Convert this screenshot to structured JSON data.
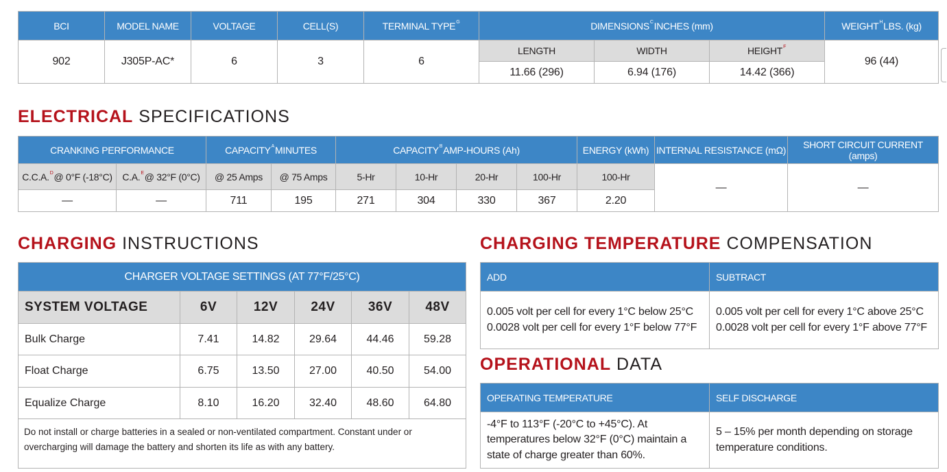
{
  "top": {
    "headers": {
      "bci": "BCI",
      "model": "MODEL NAME",
      "voltage": "VOLTAGE",
      "cells": "CELL(S)",
      "terminal": "TERMINAL TYPE",
      "terminal_sup": "G",
      "dimensions": "DIMENSIONS",
      "dimensions_sup": "C",
      "dimensions_units": "INCHES (mm)",
      "weight": "WEIGHT",
      "weight_sup": "H",
      "weight_units": "LBS. (kg)"
    },
    "dim_sub": {
      "length": "LENGTH",
      "width": "WIDTH",
      "height": "HEIGHT",
      "height_sup": "F"
    },
    "values": {
      "bci": "902",
      "model": "J305P-AC*",
      "voltage": "6",
      "cells": "3",
      "terminal": "6",
      "length": "11.66 (296)",
      "width": "6.94 (176)",
      "height": "14.42 (366)",
      "weight": "96 (44)"
    }
  },
  "electrical": {
    "title_red": "ELECTRICAL",
    "title_rest": "SPECIFICATIONS",
    "headers": {
      "cranking": "CRANKING PERFORMANCE",
      "cap_min": "CAPACITY",
      "cap_min_sup": "A",
      "cap_min_units": "MINUTES",
      "cap_ah": "CAPACITY",
      "cap_ah_sup": "B",
      "cap_ah_units": "AMP-HOURS (Ah)",
      "energy": "ENERGY (kWh)",
      "resistance": "INTERNAL RESISTANCE (mΩ)",
      "short_circuit": "SHORT CIRCUIT CURRENT (amps)"
    },
    "sub": {
      "cca": "C.C.A.",
      "cca_sup": "D",
      "cca_rest": "@ 0°F (-18°C)",
      "ca": "C.A.",
      "ca_sup": "E",
      "ca_rest": "@ 32°F (0°C)",
      "amps25": "@ 25 Amps",
      "amps75": "@ 75 Amps",
      "hr5": "5-Hr",
      "hr10": "10-Hr",
      "hr20": "20-Hr",
      "hr100": "100-Hr",
      "energy_hr100": "100-Hr"
    },
    "values": {
      "cca": "—",
      "ca": "—",
      "min25": "711",
      "min75": "195",
      "ah5": "271",
      "ah10": "304",
      "ah20": "330",
      "ah100": "367",
      "energy": "2.20",
      "resistance": "—",
      "short_circuit": "—"
    }
  },
  "charging": {
    "title_red": "CHARGING",
    "title_rest": "INSTRUCTIONS",
    "header": "CHARGER VOLTAGE SETTINGS (AT 77°F/25°C)",
    "system_label": "SYSTEM VOLTAGE",
    "voltages": [
      "6V",
      "12V",
      "24V",
      "36V",
      "48V"
    ],
    "rows": [
      {
        "label": "Bulk Charge",
        "values": [
          "7.41",
          "14.82",
          "29.64",
          "44.46",
          "59.28"
        ]
      },
      {
        "label": "Float Charge",
        "values": [
          "6.75",
          "13.50",
          "27.00",
          "40.50",
          "54.00"
        ]
      },
      {
        "label": "Equalize Charge",
        "values": [
          "8.10",
          "16.20",
          "32.40",
          "48.60",
          "64.80"
        ]
      }
    ],
    "note": "Do not install or charge batteries in a sealed or non-ventilated compartment. Constant under or overcharging will damage the battery and shorten its life as with any battery."
  },
  "compensation": {
    "title_red": "CHARGING TEMPERATURE",
    "title_rest": "COMPENSATION",
    "add_label": "ADD",
    "subtract_label": "SUBTRACT",
    "add_line1": "0.005 volt per cell for every 1°C below 25°C",
    "add_line2": "0.0028 volt per cell for every 1°F below 77°F",
    "sub_line1": "0.005 volt per cell for every 1°C above 25°C",
    "sub_line2": "0.0028 volt per cell for every 1°F above 77°F"
  },
  "operational": {
    "title_red": "OPERATIONAL",
    "title_rest": "DATA",
    "temp_label": "OPERATING TEMPERATURE",
    "discharge_label": "SELF DISCHARGE",
    "temp_value": "-4°F to 113°F (-20°C to +45°C). At temperatures below 32°F (0°C) maintain a state of charge greater than 60%.",
    "discharge_value": "5 – 15% per month depending on storage temperature conditions."
  },
  "colors": {
    "header_blue": "#3d86c6",
    "title_red": "#b5121b",
    "subheader_gray": "#dcdcdc"
  }
}
